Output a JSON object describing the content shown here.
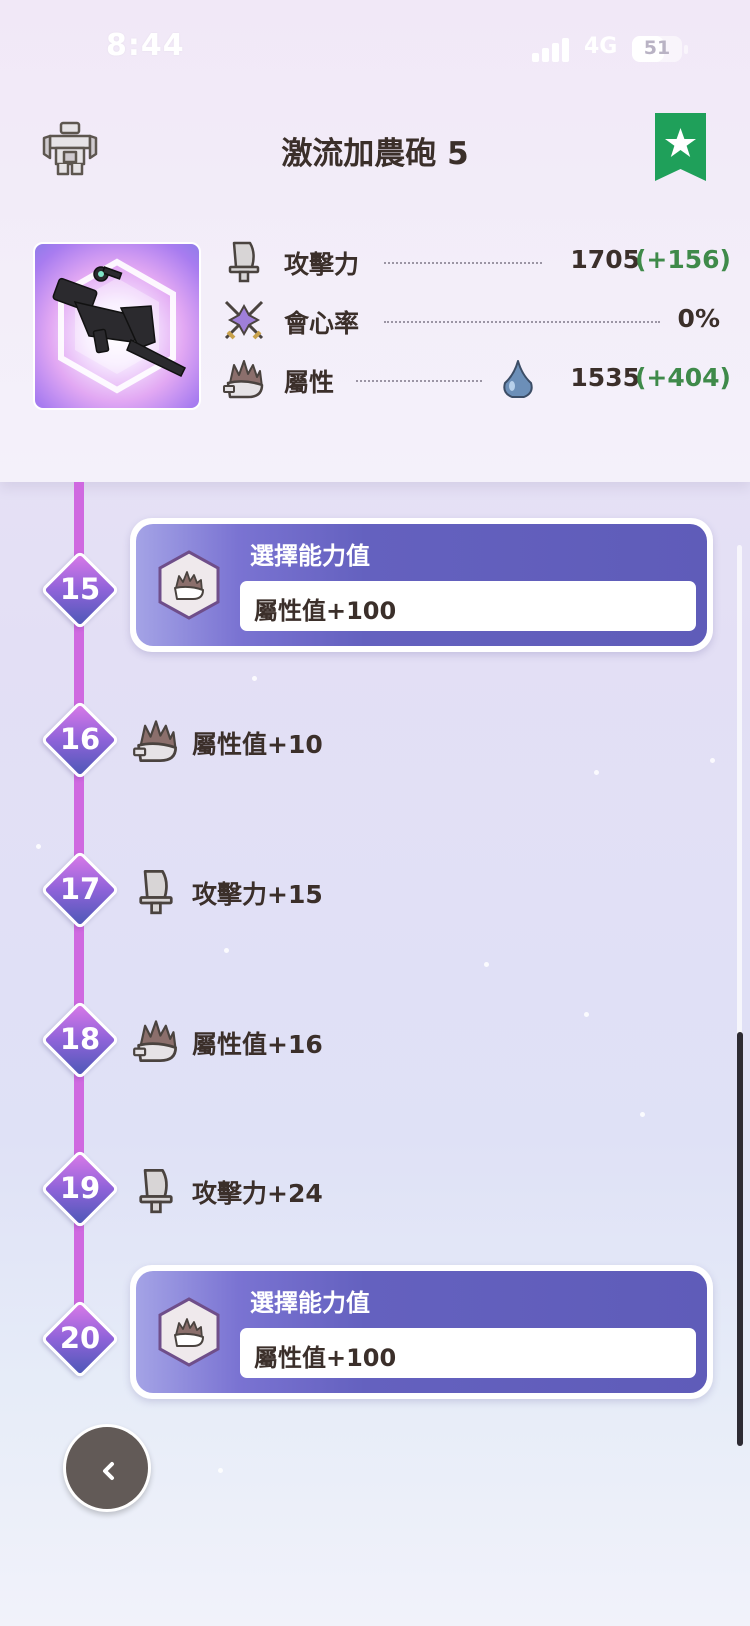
{
  "status_bar": {
    "time": "8:44",
    "network": "4G",
    "battery": "51"
  },
  "header": {
    "title": "激流加農砲 5",
    "skin_icon": "armor-set-icon",
    "favorite_icon": "star-bookmark-icon",
    "favorite_color": "#1fa05a"
  },
  "stats": {
    "attack": {
      "label": "攻擊力",
      "value": "1705",
      "bonus": "(+156)",
      "icon": "blade-icon"
    },
    "affinity": {
      "label": "會心率",
      "value": "0%",
      "icon": "crossed-blades-icon"
    },
    "element": {
      "label": "屬性",
      "value": "1535",
      "bonus": "(+404)",
      "icon": "flame-blade-icon",
      "element_icon": "water-drop-icon"
    }
  },
  "timeline": {
    "line_color": "#cf69e0",
    "levels": [
      {
        "level": "15",
        "type": "choice",
        "title": "選擇能力值",
        "value": "屬性值+100",
        "icon": "flame-blade-icon"
      },
      {
        "level": "16",
        "type": "plain",
        "text": "屬性值+10",
        "icon": "flame-blade-icon"
      },
      {
        "level": "17",
        "type": "plain",
        "text": "攻擊力+15",
        "icon": "blade-icon"
      },
      {
        "level": "18",
        "type": "plain",
        "text": "屬性值+16",
        "icon": "flame-blade-icon"
      },
      {
        "level": "19",
        "type": "plain",
        "text": "攻擊力+24",
        "icon": "blade-icon"
      },
      {
        "level": "20",
        "type": "choice",
        "title": "選擇能力值",
        "value": "屬性值+100",
        "icon": "flame-blade-icon"
      }
    ]
  },
  "back_button": {
    "icon": "chevron-left-icon"
  }
}
